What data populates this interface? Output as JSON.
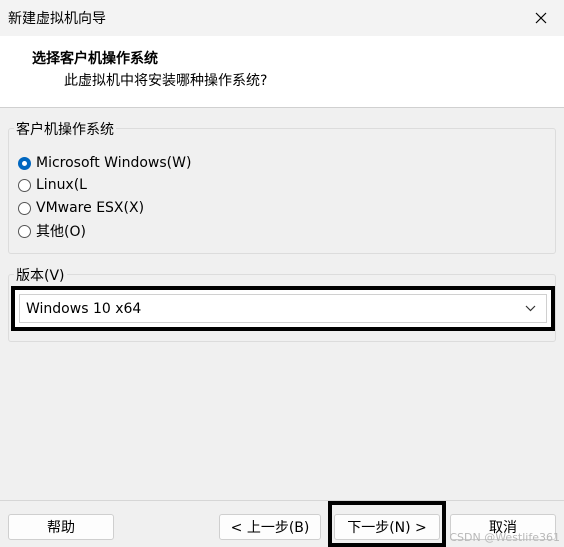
{
  "window": {
    "title": "新建虚拟机向导"
  },
  "header": {
    "title": "选择客户机操作系统",
    "subtitle": "此虚拟机中将安装哪种操作系统?"
  },
  "os_group": {
    "legend": "客户机操作系统",
    "options": [
      {
        "label": "Microsoft Windows(W)",
        "checked": true
      },
      {
        "label": "Linux(L",
        "checked": false
      },
      {
        "label": "VMware ESX(X)",
        "checked": false
      },
      {
        "label": "其他(O)",
        "checked": false
      }
    ]
  },
  "version_group": {
    "legend": "版本(V)",
    "selected": "Windows 10 x64"
  },
  "footer": {
    "help": "帮助",
    "back": "< 上一步(B)",
    "next": "下一步(N) >",
    "cancel": "取消"
  },
  "watermark": "CSDN @Westlife361",
  "icons": {
    "close": "close-icon",
    "dropdown": "chevron-down-icon"
  },
  "colors": {
    "accent": "#0067c0",
    "highlight_frame": "#000000"
  }
}
